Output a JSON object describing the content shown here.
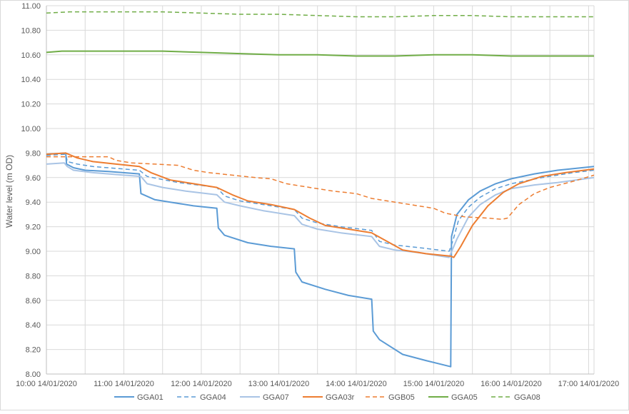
{
  "chart_data": {
    "type": "line",
    "title": "",
    "xlabel": "",
    "ylabel": "Water level (m OD)",
    "ylim": [
      8.0,
      11.0
    ],
    "y_ticks": [
      "8.00",
      "8.20",
      "8.40",
      "8.60",
      "8.80",
      "9.00",
      "9.20",
      "9.40",
      "9.60",
      "9.80",
      "10.00",
      "10.20",
      "10.40",
      "10.60",
      "10.80",
      "11.00"
    ],
    "x_range_hours": [
      10,
      17.07
    ],
    "x_ticks": [
      {
        "label": "10:00 14/01/2020",
        "hour": 10
      },
      {
        "label": "11:00 14/01/2020",
        "hour": 11
      },
      {
        "label": "12:00 14/01/2020",
        "hour": 12
      },
      {
        "label": "13:00 14/01/2020",
        "hour": 13
      },
      {
        "label": "14:00 14/01/2020",
        "hour": 14
      },
      {
        "label": "15:00 14/01/2020",
        "hour": 15
      },
      {
        "label": "16:00 14/01/2020",
        "hour": 16
      },
      {
        "label": "17:00 14/01/2020",
        "hour": 17
      }
    ],
    "grid": true,
    "legend_position": "bottom",
    "series": [
      {
        "name": "GGA01",
        "color": "#5B9BD5",
        "dash": "solid",
        "width": 2,
        "points": [
          [
            10,
            9.79
          ],
          [
            10.25,
            9.8
          ],
          [
            10.26,
            9.71
          ],
          [
            10.35,
            9.68
          ],
          [
            10.5,
            9.66
          ],
          [
            10.8,
            9.65
          ],
          [
            11.2,
            9.63
          ],
          [
            11.22,
            9.47
          ],
          [
            11.4,
            9.42
          ],
          [
            11.6,
            9.4
          ],
          [
            11.9,
            9.37
          ],
          [
            12.2,
            9.35
          ],
          [
            12.22,
            9.19
          ],
          [
            12.3,
            9.13
          ],
          [
            12.6,
            9.07
          ],
          [
            12.9,
            9.04
          ],
          [
            13.2,
            9.02
          ],
          [
            13.22,
            8.83
          ],
          [
            13.3,
            8.75
          ],
          [
            13.6,
            8.69
          ],
          [
            13.9,
            8.64
          ],
          [
            14.2,
            8.61
          ],
          [
            14.22,
            8.35
          ],
          [
            14.3,
            8.28
          ],
          [
            14.6,
            8.16
          ],
          [
            14.9,
            8.11
          ],
          [
            15.22,
            8.06
          ],
          [
            15.23,
            9.12
          ],
          [
            15.3,
            9.3
          ],
          [
            15.45,
            9.42
          ],
          [
            15.6,
            9.49
          ],
          [
            15.8,
            9.55
          ],
          [
            16.0,
            9.59
          ],
          [
            16.3,
            9.63
          ],
          [
            16.6,
            9.66
          ],
          [
            17.07,
            9.69
          ]
        ]
      },
      {
        "name": "GGA04",
        "color": "#5B9BD5",
        "dash": "6,4",
        "width": 1.5,
        "points": [
          [
            10,
            9.78
          ],
          [
            10.25,
            9.79
          ],
          [
            10.27,
            9.73
          ],
          [
            10.4,
            9.71
          ],
          [
            10.6,
            9.69
          ],
          [
            11.0,
            9.67
          ],
          [
            11.2,
            9.66
          ],
          [
            11.3,
            9.61
          ],
          [
            11.45,
            9.59
          ],
          [
            11.7,
            9.56
          ],
          [
            12.2,
            9.52
          ],
          [
            12.3,
            9.45
          ],
          [
            12.5,
            9.41
          ],
          [
            12.8,
            9.38
          ],
          [
            13.2,
            9.34
          ],
          [
            13.3,
            9.27
          ],
          [
            13.5,
            9.23
          ],
          [
            13.8,
            9.2
          ],
          [
            14.2,
            9.17
          ],
          [
            14.3,
            9.08
          ],
          [
            14.5,
            9.05
          ],
          [
            14.8,
            9.03
          ],
          [
            15.2,
            9.0
          ],
          [
            15.25,
            9.09
          ],
          [
            15.32,
            9.25
          ],
          [
            15.45,
            9.36
          ],
          [
            15.6,
            9.44
          ],
          [
            15.8,
            9.51
          ],
          [
            16.0,
            9.55
          ],
          [
            16.4,
            9.6
          ],
          [
            16.8,
            9.64
          ],
          [
            17.07,
            9.66
          ]
        ]
      },
      {
        "name": "GGA07",
        "color": "#A9C4E5",
        "dash": "solid",
        "width": 2,
        "points": [
          [
            10,
            9.71
          ],
          [
            10.23,
            9.72
          ],
          [
            10.27,
            9.69
          ],
          [
            10.35,
            9.66
          ],
          [
            10.6,
            9.64
          ],
          [
            11.0,
            9.62
          ],
          [
            11.22,
            9.61
          ],
          [
            11.3,
            9.55
          ],
          [
            11.5,
            9.52
          ],
          [
            11.8,
            9.49
          ],
          [
            12.2,
            9.46
          ],
          [
            12.3,
            9.4
          ],
          [
            12.5,
            9.37
          ],
          [
            12.8,
            9.33
          ],
          [
            13.2,
            9.29
          ],
          [
            13.3,
            9.22
          ],
          [
            13.5,
            9.18
          ],
          [
            13.8,
            9.15
          ],
          [
            14.2,
            9.12
          ],
          [
            14.3,
            9.04
          ],
          [
            14.5,
            9.01
          ],
          [
            14.8,
            8.99
          ],
          [
            15.2,
            8.95
          ],
          [
            15.3,
            9.1
          ],
          [
            15.45,
            9.28
          ],
          [
            15.6,
            9.38
          ],
          [
            15.8,
            9.46
          ],
          [
            16.0,
            9.51
          ],
          [
            16.3,
            9.54
          ],
          [
            16.6,
            9.56
          ],
          [
            17.07,
            9.6
          ]
        ]
      },
      {
        "name": "GGA03r",
        "color": "#ED7D31",
        "dash": "solid",
        "width": 2,
        "points": [
          [
            10,
            9.79
          ],
          [
            10.25,
            9.8
          ],
          [
            10.4,
            9.76
          ],
          [
            10.6,
            9.73
          ],
          [
            10.9,
            9.71
          ],
          [
            11.2,
            9.69
          ],
          [
            11.35,
            9.64
          ],
          [
            11.6,
            9.58
          ],
          [
            11.9,
            9.55
          ],
          [
            12.2,
            9.52
          ],
          [
            12.4,
            9.46
          ],
          [
            12.6,
            9.41
          ],
          [
            12.9,
            9.38
          ],
          [
            13.2,
            9.34
          ],
          [
            13.4,
            9.27
          ],
          [
            13.6,
            9.21
          ],
          [
            13.9,
            9.18
          ],
          [
            14.2,
            9.15
          ],
          [
            14.4,
            9.08
          ],
          [
            14.6,
            9.01
          ],
          [
            14.9,
            8.98
          ],
          [
            15.22,
            8.96
          ],
          [
            15.26,
            8.95
          ],
          [
            15.35,
            9.04
          ],
          [
            15.5,
            9.21
          ],
          [
            15.7,
            9.37
          ],
          [
            15.9,
            9.48
          ],
          [
            16.1,
            9.55
          ],
          [
            16.4,
            9.61
          ],
          [
            16.7,
            9.64
          ],
          [
            17.07,
            9.67
          ]
        ]
      },
      {
        "name": "GGB05",
        "color": "#ED7D31",
        "dash": "6,4",
        "width": 1.5,
        "points": [
          [
            10,
            9.77
          ],
          [
            10.2,
            9.77
          ],
          [
            10.5,
            9.77
          ],
          [
            10.8,
            9.77
          ],
          [
            10.9,
            9.74
          ],
          [
            11.1,
            9.72
          ],
          [
            11.4,
            9.71
          ],
          [
            11.7,
            9.7
          ],
          [
            11.9,
            9.66
          ],
          [
            12.1,
            9.64
          ],
          [
            12.4,
            9.62
          ],
          [
            12.7,
            9.6
          ],
          [
            12.9,
            9.59
          ],
          [
            13.1,
            9.55
          ],
          [
            13.4,
            9.52
          ],
          [
            13.7,
            9.49
          ],
          [
            14.0,
            9.47
          ],
          [
            14.2,
            9.43
          ],
          [
            14.5,
            9.4
          ],
          [
            14.8,
            9.37
          ],
          [
            15.0,
            9.35
          ],
          [
            15.15,
            9.31
          ],
          [
            15.4,
            9.28
          ],
          [
            15.7,
            9.27
          ],
          [
            15.88,
            9.26
          ],
          [
            15.95,
            9.27
          ],
          [
            16.1,
            9.38
          ],
          [
            16.3,
            9.47
          ],
          [
            16.5,
            9.52
          ],
          [
            16.8,
            9.57
          ],
          [
            17.07,
            9.62
          ]
        ]
      },
      {
        "name": "GGA05",
        "color": "#70AD47",
        "dash": "solid",
        "width": 2,
        "points": [
          [
            10,
            10.62
          ],
          [
            10.2,
            10.63
          ],
          [
            11.0,
            10.63
          ],
          [
            11.5,
            10.63
          ],
          [
            12.0,
            10.62
          ],
          [
            12.5,
            10.61
          ],
          [
            13.0,
            10.6
          ],
          [
            13.5,
            10.6
          ],
          [
            14.0,
            10.59
          ],
          [
            14.5,
            10.59
          ],
          [
            15.0,
            10.6
          ],
          [
            15.5,
            10.6
          ],
          [
            16.0,
            10.59
          ],
          [
            16.5,
            10.59
          ],
          [
            17.07,
            10.59
          ]
        ]
      },
      {
        "name": "GGA08",
        "color": "#70AD47",
        "dash": "6,4",
        "width": 1.5,
        "points": [
          [
            10,
            10.94
          ],
          [
            10.3,
            10.95
          ],
          [
            11.0,
            10.95
          ],
          [
            11.5,
            10.95
          ],
          [
            12.0,
            10.94
          ],
          [
            12.5,
            10.93
          ],
          [
            13.0,
            10.93
          ],
          [
            13.5,
            10.92
          ],
          [
            14.0,
            10.91
          ],
          [
            14.5,
            10.91
          ],
          [
            15.0,
            10.92
          ],
          [
            15.5,
            10.92
          ],
          [
            16.0,
            10.91
          ],
          [
            16.5,
            10.91
          ],
          [
            17.07,
            10.91
          ]
        ]
      }
    ]
  }
}
